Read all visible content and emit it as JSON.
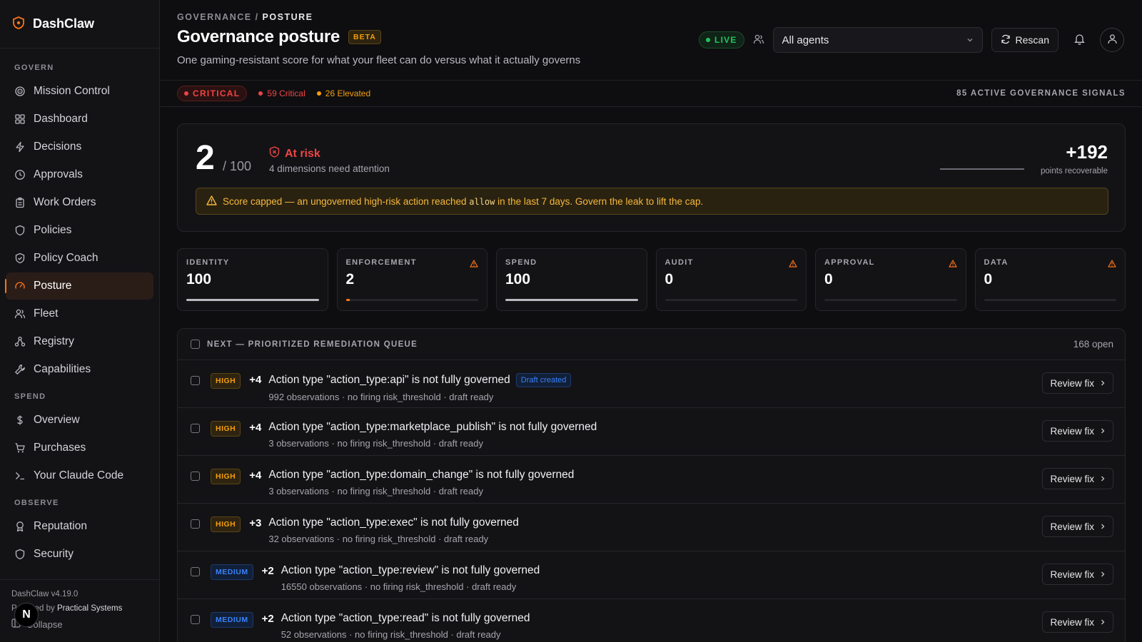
{
  "app": {
    "name": "DashClaw",
    "version": "DashClaw v4.19.0",
    "powered_prefix": "Powered by",
    "powered_by": "Practical Systems",
    "collapse": "Collapse",
    "n_badge": "N"
  },
  "sidebar": {
    "govern_label": "GOVERN",
    "govern": [
      {
        "label": "Mission Control",
        "icon": "target-icon"
      },
      {
        "label": "Dashboard",
        "icon": "grid-icon"
      },
      {
        "label": "Decisions",
        "icon": "bolt-icon"
      },
      {
        "label": "Approvals",
        "icon": "clock-icon"
      },
      {
        "label": "Work Orders",
        "icon": "clipboard-icon"
      },
      {
        "label": "Policies",
        "icon": "shield-icon"
      },
      {
        "label": "Policy Coach",
        "icon": "shield-check-icon"
      },
      {
        "label": "Posture",
        "icon": "gauge-icon",
        "active": true
      },
      {
        "label": "Fleet",
        "icon": "users-icon"
      },
      {
        "label": "Registry",
        "icon": "nodes-icon"
      },
      {
        "label": "Capabilities",
        "icon": "wrench-icon"
      }
    ],
    "spend_label": "SPEND",
    "spend": [
      {
        "label": "Overview",
        "icon": "dollar-icon"
      },
      {
        "label": "Purchases",
        "icon": "cart-icon"
      },
      {
        "label": "Your Claude Code",
        "icon": "terminal-icon"
      }
    ],
    "observe_label": "OBSERVE",
    "observe": [
      {
        "label": "Reputation",
        "icon": "award-icon"
      },
      {
        "label": "Security",
        "icon": "shield-icon"
      }
    ]
  },
  "header": {
    "crumb_parent": "GOVERNANCE",
    "crumb_sep": "/",
    "crumb_current": "POSTURE",
    "title": "Governance posture",
    "beta": "BETA",
    "subtitle": "One gaming-resistant score for what your fleet can do versus what it actually governs",
    "live": "LIVE",
    "agent_select": "All agents",
    "rescan": "Rescan"
  },
  "status": {
    "level": "CRITICAL",
    "critical": "59 Critical",
    "elevated": "26 Elevated",
    "signals": "85 ACTIVE GOVERNANCE SIGNALS",
    "colors": {
      "critical": "#ef4444",
      "elevated": "#f59e0b"
    }
  },
  "score": {
    "value": "2",
    "of": "/ 100",
    "risk": "At risk",
    "risk_sub": "4 dimensions need attention",
    "recover": "+192",
    "recover_label": "points recoverable",
    "banner_pre": "Score capped — an ungoverned high-risk action reached",
    "banner_code": "allow",
    "banner_post": "in the last 7 days. Govern the leak to lift the cap."
  },
  "dimensions": [
    {
      "label": "IDENTITY",
      "value": "100",
      "fill": 1.0,
      "warn": false
    },
    {
      "label": "ENFORCEMENT",
      "value": "2",
      "fill": 0.02,
      "warn": true
    },
    {
      "label": "SPEND",
      "value": "100",
      "fill": 1.0,
      "warn": false
    },
    {
      "label": "AUDIT",
      "value": "0",
      "fill": 0,
      "warn": true
    },
    {
      "label": "APPROVAL",
      "value": "0",
      "fill": 0,
      "warn": true
    },
    {
      "label": "DATA",
      "value": "0",
      "fill": 0,
      "warn": true
    }
  ],
  "queue": {
    "title": "NEXT — PRIORITIZED REMEDIATION QUEUE",
    "open": "168 open",
    "review_label": "Review fix",
    "draft_label": "Draft created",
    "rows": [
      {
        "sev": "HIGH",
        "pts": "+4",
        "title": "Action type \"action_type:api\" is not fully governed",
        "draft": true,
        "sub": "992 observations · no firing risk_threshold · draft ready"
      },
      {
        "sev": "HIGH",
        "pts": "+4",
        "title": "Action type \"action_type:marketplace_publish\" is not fully governed",
        "draft": false,
        "sub": "3 observations · no firing risk_threshold · draft ready"
      },
      {
        "sev": "HIGH",
        "pts": "+4",
        "title": "Action type \"action_type:domain_change\" is not fully governed",
        "draft": false,
        "sub": "3 observations · no firing risk_threshold · draft ready"
      },
      {
        "sev": "HIGH",
        "pts": "+3",
        "title": "Action type \"action_type:exec\" is not fully governed",
        "draft": false,
        "sub": "32 observations · no firing risk_threshold · draft ready"
      },
      {
        "sev": "MEDIUM",
        "pts": "+2",
        "title": "Action type \"action_type:review\" is not fully governed",
        "draft": false,
        "sub": "16550 observations · no firing risk_threshold · draft ready"
      },
      {
        "sev": "MEDIUM",
        "pts": "+2",
        "title": "Action type \"action_type:read\" is not fully governed",
        "draft": false,
        "sub": "52 observations · no firing risk_threshold · draft ready"
      }
    ]
  }
}
